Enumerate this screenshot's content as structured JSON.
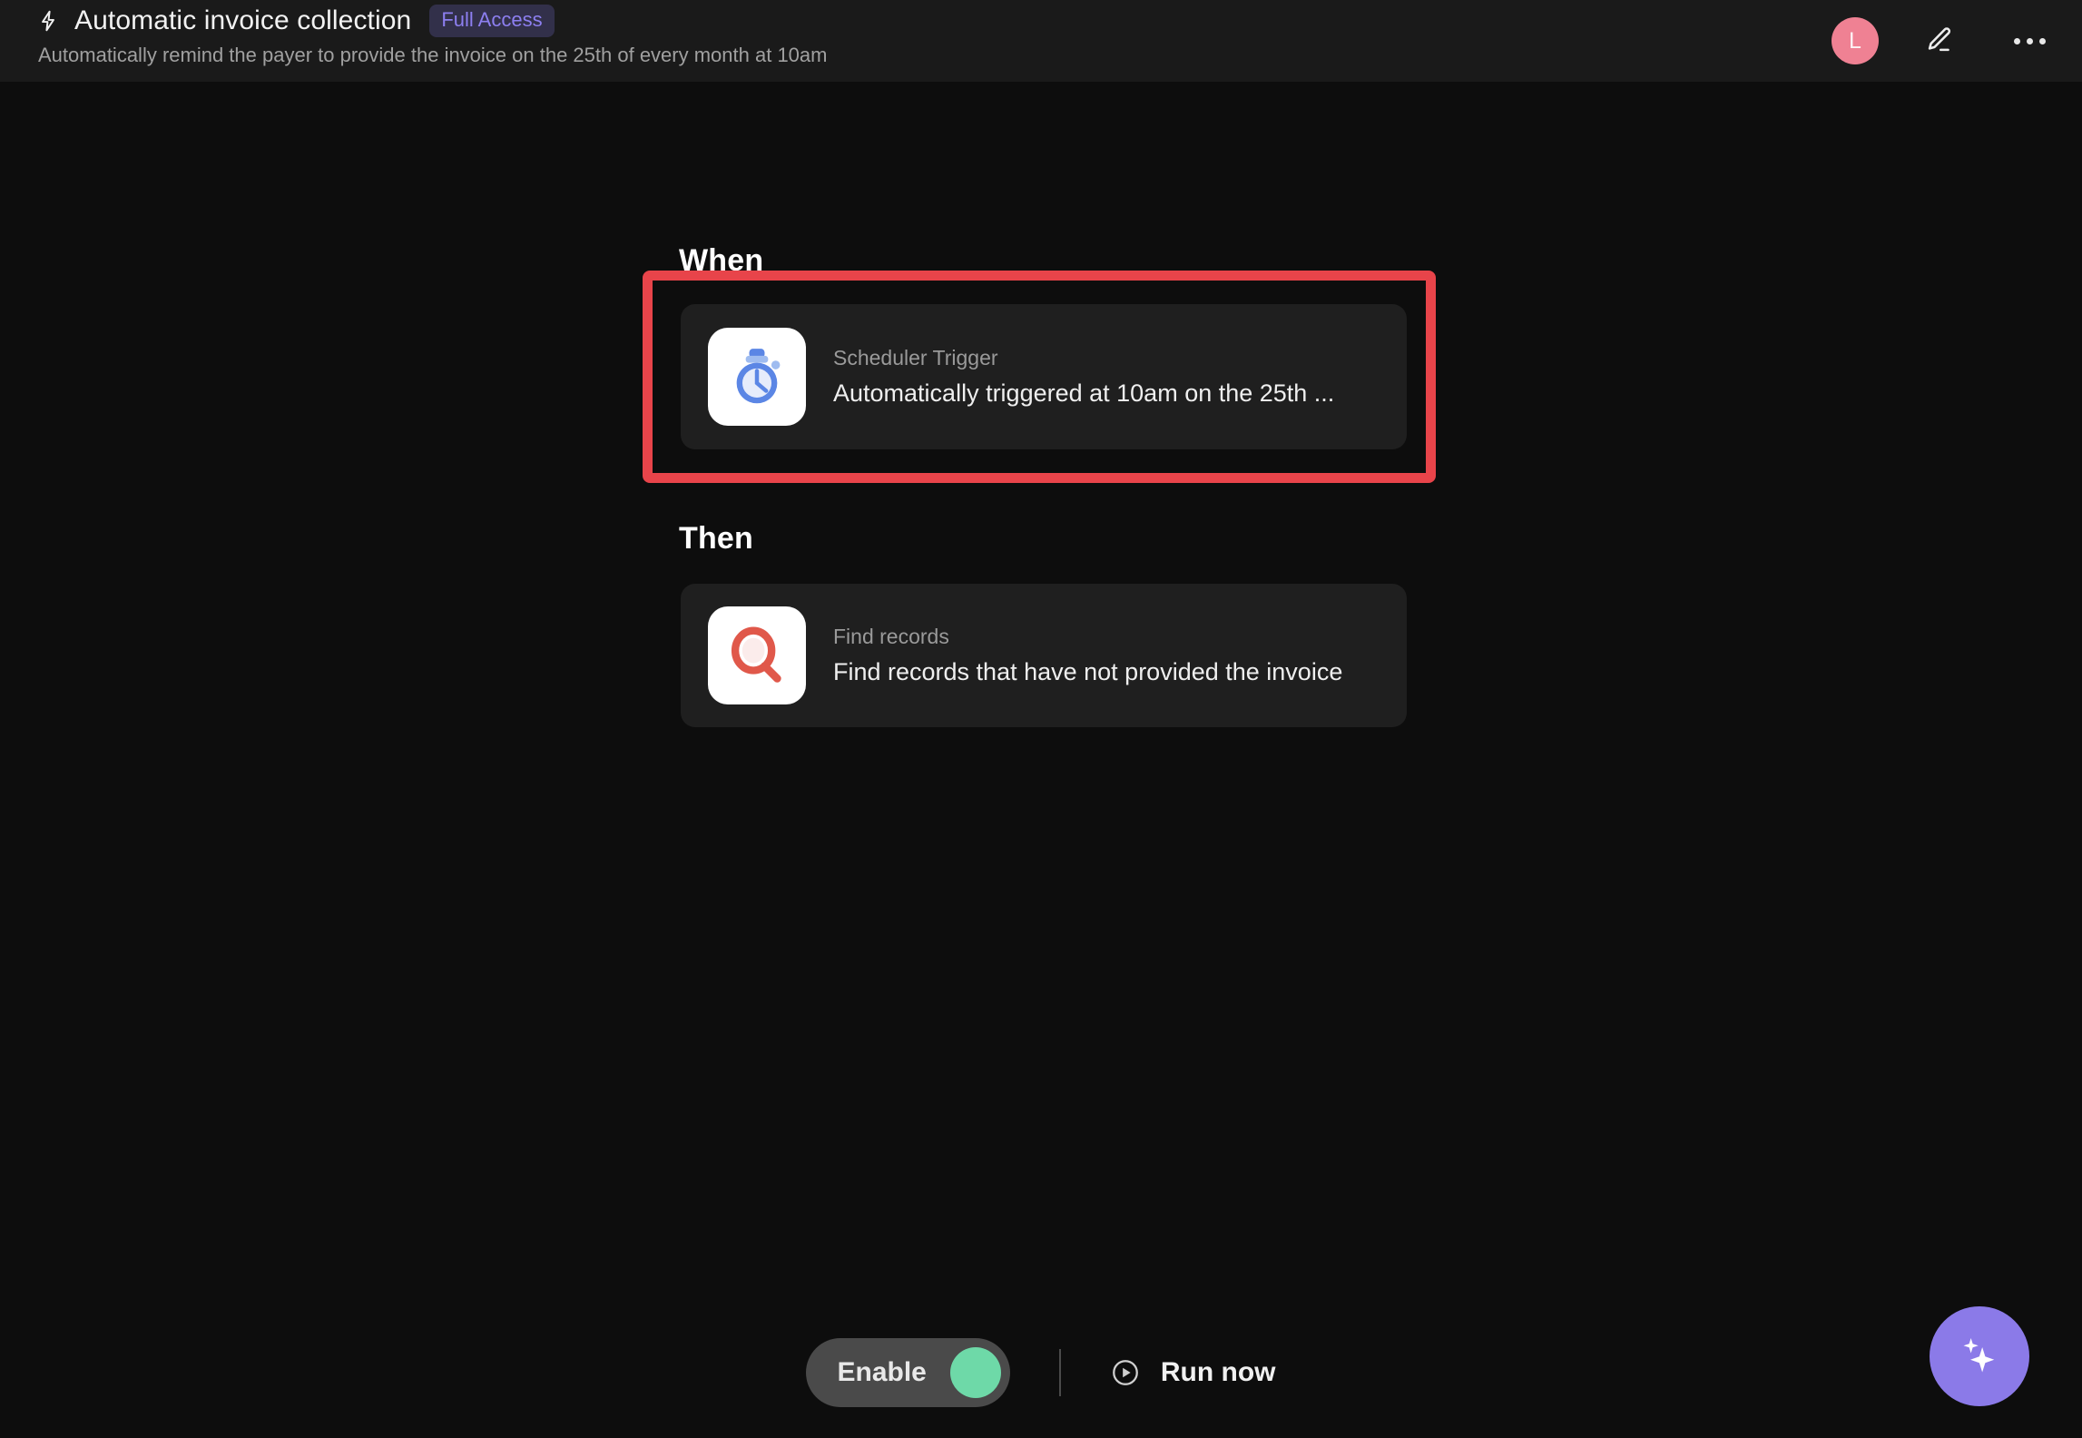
{
  "header": {
    "bolt_icon": "lightning-bolt-icon",
    "title": "Automatic invoice collection",
    "badge": "Full Access",
    "subtitle": "Automatically remind the payer to provide the invoice on the 25th of every month at 10am",
    "avatar_initial": "L",
    "edit_icon": "pencil-edit-icon",
    "more_icon": "more-options-icon"
  },
  "nav": {
    "edge_menu_icon": "hamburger-menu-icon"
  },
  "sections": {
    "when_label": "When",
    "then_label": "Then"
  },
  "steps": {
    "trigger": {
      "icon": "stopwatch-icon",
      "kicker": "Scheduler Trigger",
      "description": "Automatically triggered at 10am on the 25th ..."
    },
    "action": {
      "icon": "magnifying-glass-icon",
      "kicker": "Find records",
      "description": "Find records that have not provided the invoice"
    }
  },
  "highlight": {
    "color": "#e8444a",
    "target": "scheduler-trigger-card"
  },
  "bottom_bar": {
    "enable_label": "Enable",
    "enable_state": "on",
    "toggle_color": "#6ed9a8",
    "run_now_label": "Run now",
    "run_now_icon": "play-circle-icon"
  },
  "fab": {
    "icon": "ai-sparkle-icon",
    "color": "#8b7ae8"
  }
}
